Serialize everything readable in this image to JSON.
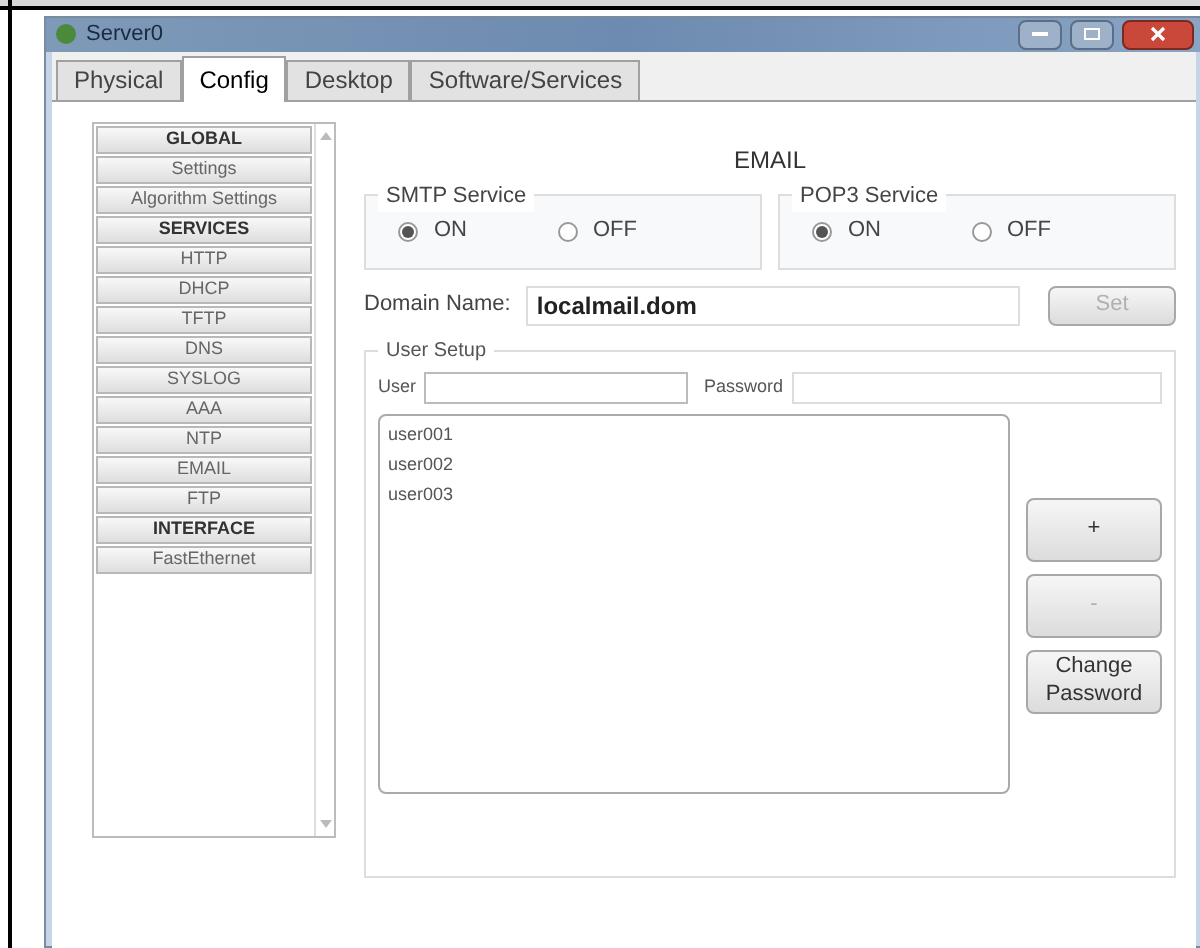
{
  "window": {
    "title": "Server0"
  },
  "tabs": [
    {
      "label": "Physical",
      "selected": false
    },
    {
      "label": "Config",
      "selected": true
    },
    {
      "label": "Desktop",
      "selected": false
    },
    {
      "label": "Software/Services",
      "selected": false
    }
  ],
  "sidebar": {
    "items": [
      {
        "label": "GLOBAL",
        "kind": "header"
      },
      {
        "label": "Settings",
        "kind": "item"
      },
      {
        "label": "Algorithm Settings",
        "kind": "item"
      },
      {
        "label": "SERVICES",
        "kind": "header"
      },
      {
        "label": "HTTP",
        "kind": "item"
      },
      {
        "label": "DHCP",
        "kind": "item"
      },
      {
        "label": "TFTP",
        "kind": "item"
      },
      {
        "label": "DNS",
        "kind": "item"
      },
      {
        "label": "SYSLOG",
        "kind": "item"
      },
      {
        "label": "AAA",
        "kind": "item"
      },
      {
        "label": "NTP",
        "kind": "item"
      },
      {
        "label": "EMAIL",
        "kind": "item"
      },
      {
        "label": "FTP",
        "kind": "item"
      },
      {
        "label": "INTERFACE",
        "kind": "header"
      },
      {
        "label": "FastEthernet",
        "kind": "item"
      }
    ]
  },
  "panel": {
    "title": "EMAIL",
    "services": [
      {
        "title": "SMTP Service",
        "options": [
          {
            "label": "ON",
            "selected": true
          },
          {
            "label": "OFF",
            "selected": false
          }
        ]
      },
      {
        "title": "POP3 Service",
        "options": [
          {
            "label": "ON",
            "selected": true
          },
          {
            "label": "OFF",
            "selected": false
          }
        ]
      }
    ],
    "domain": {
      "label": "Domain Name:",
      "value": "localmail.dom",
      "button": {
        "label": "Set",
        "disabled": true
      }
    },
    "user_setup": {
      "title": "User Setup",
      "user_label": "User",
      "password_label": "Password",
      "users": [
        "user001",
        "user002",
        "user003"
      ],
      "buttons": [
        {
          "label": "+",
          "disabled": false
        },
        {
          "label": "-",
          "disabled": true
        },
        {
          "label": "Change Password",
          "disabled": false
        }
      ]
    }
  }
}
